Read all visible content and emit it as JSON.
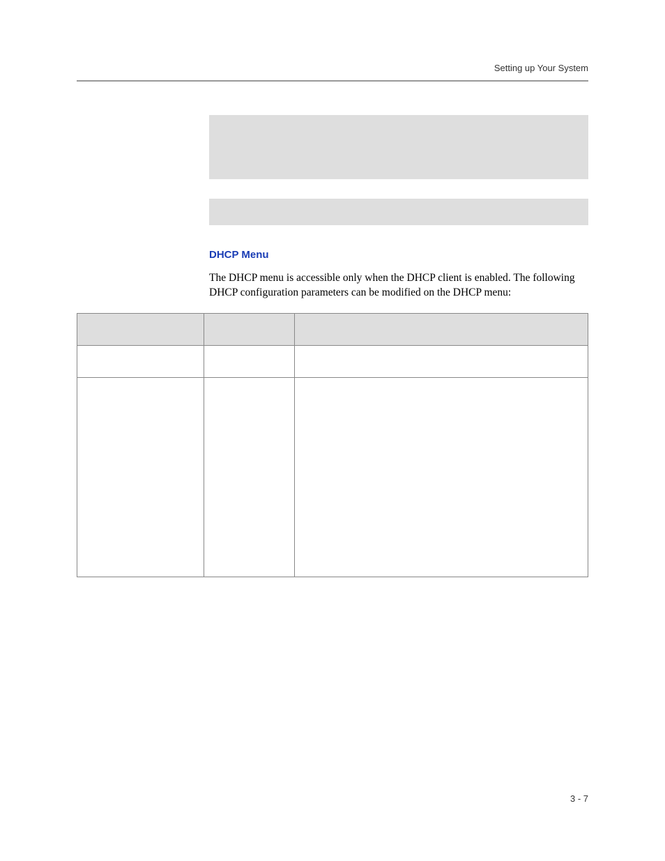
{
  "header": {
    "running_head": "Setting up Your System"
  },
  "section": {
    "title": "DHCP Menu",
    "paragraph": "The DHCP menu is accessible only when the DHCP client is enabled. The following DHCP configuration parameters can be modified on the DHCP menu:"
  },
  "table": {
    "headers": [
      "",
      "",
      ""
    ],
    "rows": [
      {
        "c1": "",
        "c2": "",
        "c3": ""
      },
      {
        "c1": "",
        "c2": "",
        "c3": ""
      }
    ]
  },
  "footer": {
    "page_number": "3 - 7"
  }
}
